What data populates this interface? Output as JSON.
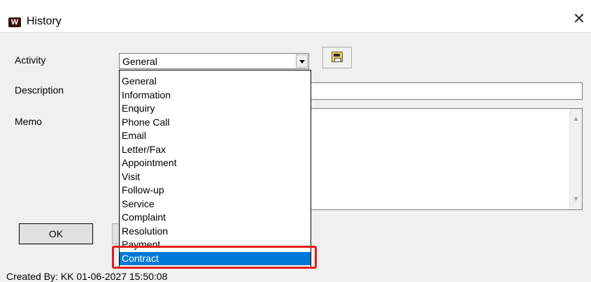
{
  "window": {
    "title": "History",
    "app_icon_glyph": "W",
    "close_glyph": "✕"
  },
  "form": {
    "activity_label": "Activity",
    "activity_value": "General",
    "description_label": "Description",
    "memo_label": "Memo"
  },
  "dropdown": {
    "items": [
      "General",
      "Information",
      "Enquiry",
      "Phone Call",
      "Email",
      "Letter/Fax",
      "Appointment",
      "Visit",
      "Follow-up",
      "Service",
      "Complaint",
      "Resolution",
      "Payment",
      "Contract"
    ],
    "selected_index": 13
  },
  "buttons": {
    "ok_label": "OK"
  },
  "status": {
    "created_by": "Created By: KK 01-06-2027 15:50:08"
  },
  "icons": {
    "toolbar_icon": "clipboard-folder-icon",
    "scroll_up": "▲",
    "scroll_down": "▼"
  },
  "colors": {
    "selection": "#0078d7",
    "highlight": "#e11b1b"
  }
}
